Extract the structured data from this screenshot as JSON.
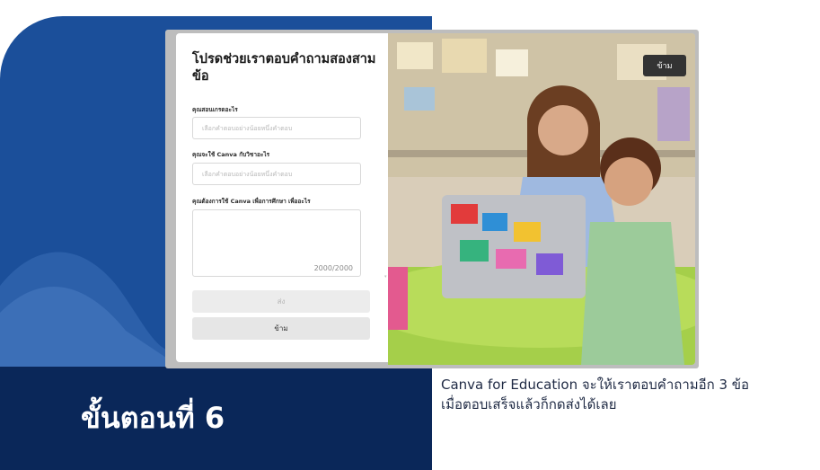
{
  "slide": {
    "step_title": "ขั้นตอนที่ 6",
    "description_line1": "Canva for Education จะให้เราตอบคำถามอีก 3 ข้อ",
    "description_line2": "เมื่อตอบเสร็จแล้วก็กดส่งได้เลย"
  },
  "dialog": {
    "heading": "โปรดช่วยเราตอบคำถามสองสามข้อ",
    "q1_label": "คุณสอนเกรดอะไร",
    "q1_placeholder": "เลือกคำตอบอย่างน้อยหนึ่งคำตอบ",
    "q2_label": "คุณจะใช้ Canva กับวิชาอะไร",
    "q2_placeholder": "เลือกคำตอบอย่างน้อยหนึ่งคำตอบ",
    "q3_label": "คุณต้องการใช้ Canva เพื่อการศึกษา เพื่ออะไร",
    "char_counter": "2000/2000",
    "submit_label": "ส่ง",
    "skip_label": "ข้าม"
  },
  "photo": {
    "skip_label": "ข้าม"
  },
  "colors": {
    "panel_blue": "#1b4f9a",
    "band_navy": "#0a2759",
    "skip_dark": "#333333"
  }
}
